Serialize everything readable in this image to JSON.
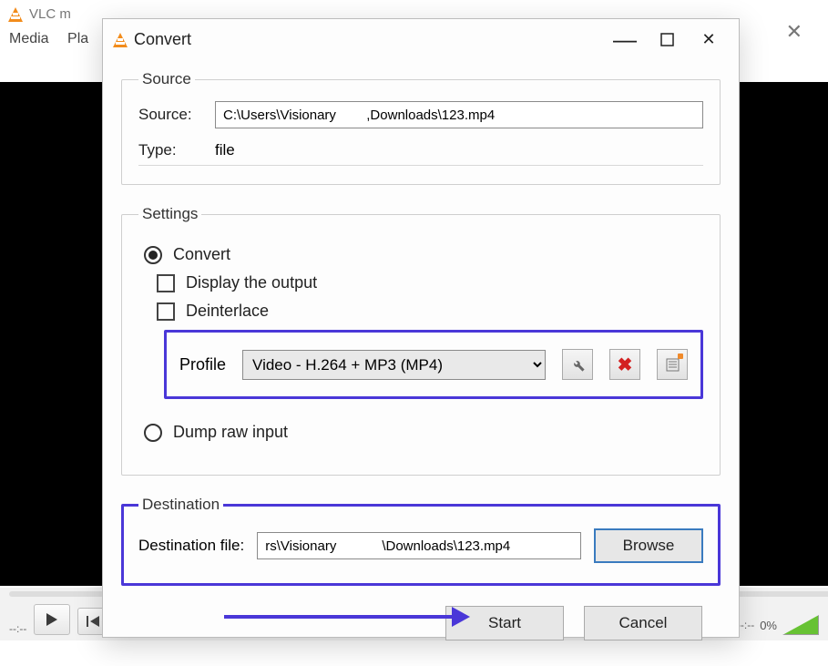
{
  "mainwin": {
    "title": "VLC m",
    "menu": {
      "media": "Media",
      "playback": "Pla"
    },
    "time_left": "--:--",
    "time_right": "--:--",
    "volume": "0%"
  },
  "dialog": {
    "title": "Convert",
    "source": {
      "legend": "Source",
      "label": "Source:",
      "value": "C:\\Users\\Visionary        ,Downloads\\123.mp4",
      "type_label": "Type:",
      "type_value": "file"
    },
    "settings": {
      "legend": "Settings",
      "convert_label": "Convert",
      "display_label": "Display the output",
      "deinterlace_label": "Deinterlace",
      "profile_label": "Profile",
      "profile_value": "Video - H.264 + MP3 (MP4)",
      "dump_label": "Dump raw input"
    },
    "destination": {
      "legend": "Destination",
      "label": "Destination file:",
      "value": "rs\\Visionary            \\Downloads\\123.mp4",
      "browse": "Browse"
    },
    "footer": {
      "start": "Start",
      "cancel": "Cancel"
    }
  }
}
